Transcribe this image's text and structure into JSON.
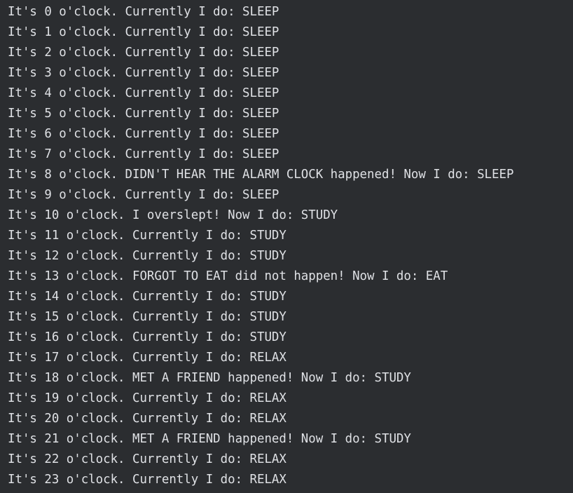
{
  "console": {
    "lines": [
      "It's 0 o'clock. Currently I do: SLEEP",
      "It's 1 o'clock. Currently I do: SLEEP",
      "It's 2 o'clock. Currently I do: SLEEP",
      "It's 3 o'clock. Currently I do: SLEEP",
      "It's 4 o'clock. Currently I do: SLEEP",
      "It's 5 o'clock. Currently I do: SLEEP",
      "It's 6 o'clock. Currently I do: SLEEP",
      "It's 7 o'clock. Currently I do: SLEEP",
      "It's 8 o'clock. DIDN'T HEAR THE ALARM CLOCK happened! Now I do: SLEEP",
      "It's 9 o'clock. Currently I do: SLEEP",
      "It's 10 o'clock. I overslept! Now I do: STUDY",
      "It's 11 o'clock. Currently I do: STUDY",
      "It's 12 o'clock. Currently I do: STUDY",
      "It's 13 o'clock. FORGOT TO EAT did not happen! Now I do: EAT",
      "It's 14 o'clock. Currently I do: STUDY",
      "It's 15 o'clock. Currently I do: STUDY",
      "It's 16 o'clock. Currently I do: STUDY",
      "It's 17 o'clock. Currently I do: RELAX",
      "It's 18 o'clock. MET A FRIEND happened! Now I do: STUDY",
      "It's 19 o'clock. Currently I do: RELAX",
      "It's 20 o'clock. Currently I do: RELAX",
      "It's 21 o'clock. MET A FRIEND happened! Now I do: STUDY",
      "It's 22 o'clock. Currently I do: RELAX",
      "It's 23 o'clock. Currently I do: RELAX"
    ]
  },
  "colors": {
    "background": "#2b2d30",
    "text": "#dfe1e5"
  }
}
